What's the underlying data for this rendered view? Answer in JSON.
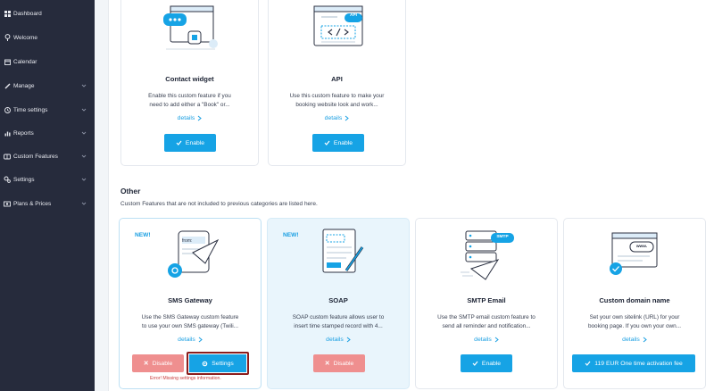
{
  "sidebar": {
    "items": [
      {
        "label": "Dashboard",
        "icon": "dashboard-icon",
        "chevron": false
      },
      {
        "label": "Welcome",
        "icon": "welcome-icon",
        "chevron": false
      },
      {
        "label": "Calendar",
        "icon": "calendar-icon",
        "chevron": false
      },
      {
        "label": "Manage",
        "icon": "manage-icon",
        "chevron": true
      },
      {
        "label": "Time settings",
        "icon": "clock-icon",
        "chevron": true
      },
      {
        "label": "Reports",
        "icon": "reports-icon",
        "chevron": true
      },
      {
        "label": "Custom Features",
        "icon": "puzzle-icon",
        "chevron": true
      },
      {
        "label": "Settings",
        "icon": "gear-icon",
        "chevron": true
      },
      {
        "label": "Plans & Prices",
        "icon": "price-tag-icon",
        "chevron": true
      }
    ]
  },
  "top_cards": [
    {
      "title": "Contact widget",
      "desc_line1": "Enable this custom feature if you",
      "desc_line2": "need to add either a \"Book\" or...",
      "details": "details",
      "button": "Enable"
    },
    {
      "title": "API",
      "desc_line1": "Use this custom feature to make your",
      "desc_line2": "booking website look and work...",
      "details": "details",
      "button": "Enable",
      "api_badge": "API"
    }
  ],
  "other": {
    "title": "Other",
    "desc": "Custom Features that are not included to previous categories are listed here."
  },
  "other_cards": [
    {
      "badge": "NEW!",
      "title": "SMS Gateway",
      "desc_line1": "Use the SMS Gateway custom feature",
      "desc_line2": "to use your own SMS gateway (Twili...",
      "details": "details",
      "button_disable": "Disable",
      "button_settings": "Settings",
      "error": "Error! Missing settings information.",
      "illus_text": "from:"
    },
    {
      "badge": "NEW!",
      "title": "SOAP",
      "desc_line1": "SOAP custom feature allows user to",
      "desc_line2": "insert time stamped record with 4...",
      "details": "details",
      "button_disable": "Disable"
    },
    {
      "title": "SMTP Email",
      "desc_line1": "Use the SMTP email custom feature to",
      "desc_line2": "send all reminder and notification...",
      "details": "details",
      "button": "Enable",
      "smtp_badge": "SMTP"
    },
    {
      "title": "Custom domain name",
      "desc_line1": "Set your own sitelink (URL) for your",
      "desc_line2": "booking page. If you own your own...",
      "details": "details",
      "button": "119 EUR One time activation fee",
      "www_badge": "www."
    }
  ],
  "colors": {
    "accent": "#16a3e5",
    "danger": "#ef8f8f",
    "sidebar": "#262b3c"
  }
}
